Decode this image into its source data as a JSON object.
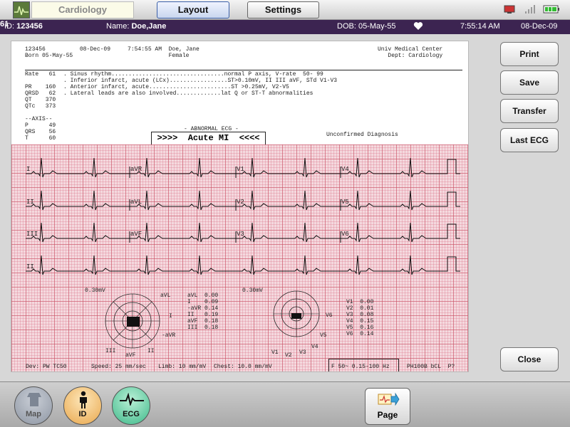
{
  "topbar": {
    "app_tab": "Cardiology",
    "layout_btn": "Layout",
    "settings_btn": "Settings"
  },
  "patient": {
    "id_label": "ID:",
    "id": "123456",
    "name_label": "Name:",
    "name": "Doe,Jane",
    "dob": "DOB: 05-May-55",
    "hr": "61",
    "time": "7:55:14 AM",
    "date": "08-Dec-09"
  },
  "report": {
    "header_left": "123456          08-Dec-09     7:54:55 AM  Doe, Jane\nBorn 05-May-55                            Female",
    "header_right": "Univ Medical Center\nDept: Cardiology",
    "meas_left": "Rate   61\n\nPR    160\nQRSD   62\nQT    370\nQTc   373\n\n--AXIS--\nP      49\nQRS    56\nT      60",
    "interp": ". Sinus rhythm.................................normal P axis, V-rate  50- 99\n. Inferior infarct, acute (LCx).................ST>0.10mV, II III aVF, STd V1-V3\n. Anterior infarct, acute........................ST >0.25mV, V2-V5\n. Lateral leads are also involved.............lat Q or ST-T abnormalities",
    "abnormal": "- ABNORMAL ECG -",
    "diagnosis": ">>>>  Acute MI  <<<<",
    "unconfirmed": "Unconfirmed Diagnosis",
    "leads": [
      "I",
      "aVR",
      "V1",
      "V4",
      "II",
      "aVL",
      "V2",
      "V5",
      "III",
      "aVF",
      "V3",
      "V6",
      "II"
    ],
    "scale_left": "0.30mV",
    "scale_right": "0.30mV",
    "limb_vals": "aVL  0.00\nI    0.09\n-aVR 0.14\nII   0.19\naVF  0.18\nIII  0.18",
    "chest_vals": "V1  0.00\nV2  0.01\nV3  0.08\nV4  0.15\nV5  0.16\nV6  0.14",
    "limb_labels": {
      "avl": "aVL",
      "i": "I",
      "avr": "-aVR",
      "ii": "II",
      "avf": "aVF",
      "iii": "III"
    },
    "chest_labels": {
      "v1": "V1",
      "v2": "V2",
      "v3": "V3",
      "v4": "V4",
      "v5": "V5",
      "v6": "V6"
    },
    "footer_dev": "Dev: PW TC50",
    "footer_speed": "Speed: 25 mm/sec",
    "footer_limb": "Limb: 10 mm/mV",
    "footer_chest": "Chest: 10.0 mm/mV",
    "footer_filter": "F 50~ 0.15-100 Hz",
    "footer_code": "PH100B bCL  P?"
  },
  "actions": {
    "print": "Print",
    "save": "Save",
    "transfer": "Transfer",
    "last_ecg": "Last ECG",
    "close": "Close"
  },
  "dock": {
    "map": "Map",
    "id": "ID",
    "ecg": "ECG",
    "page": "Page"
  }
}
